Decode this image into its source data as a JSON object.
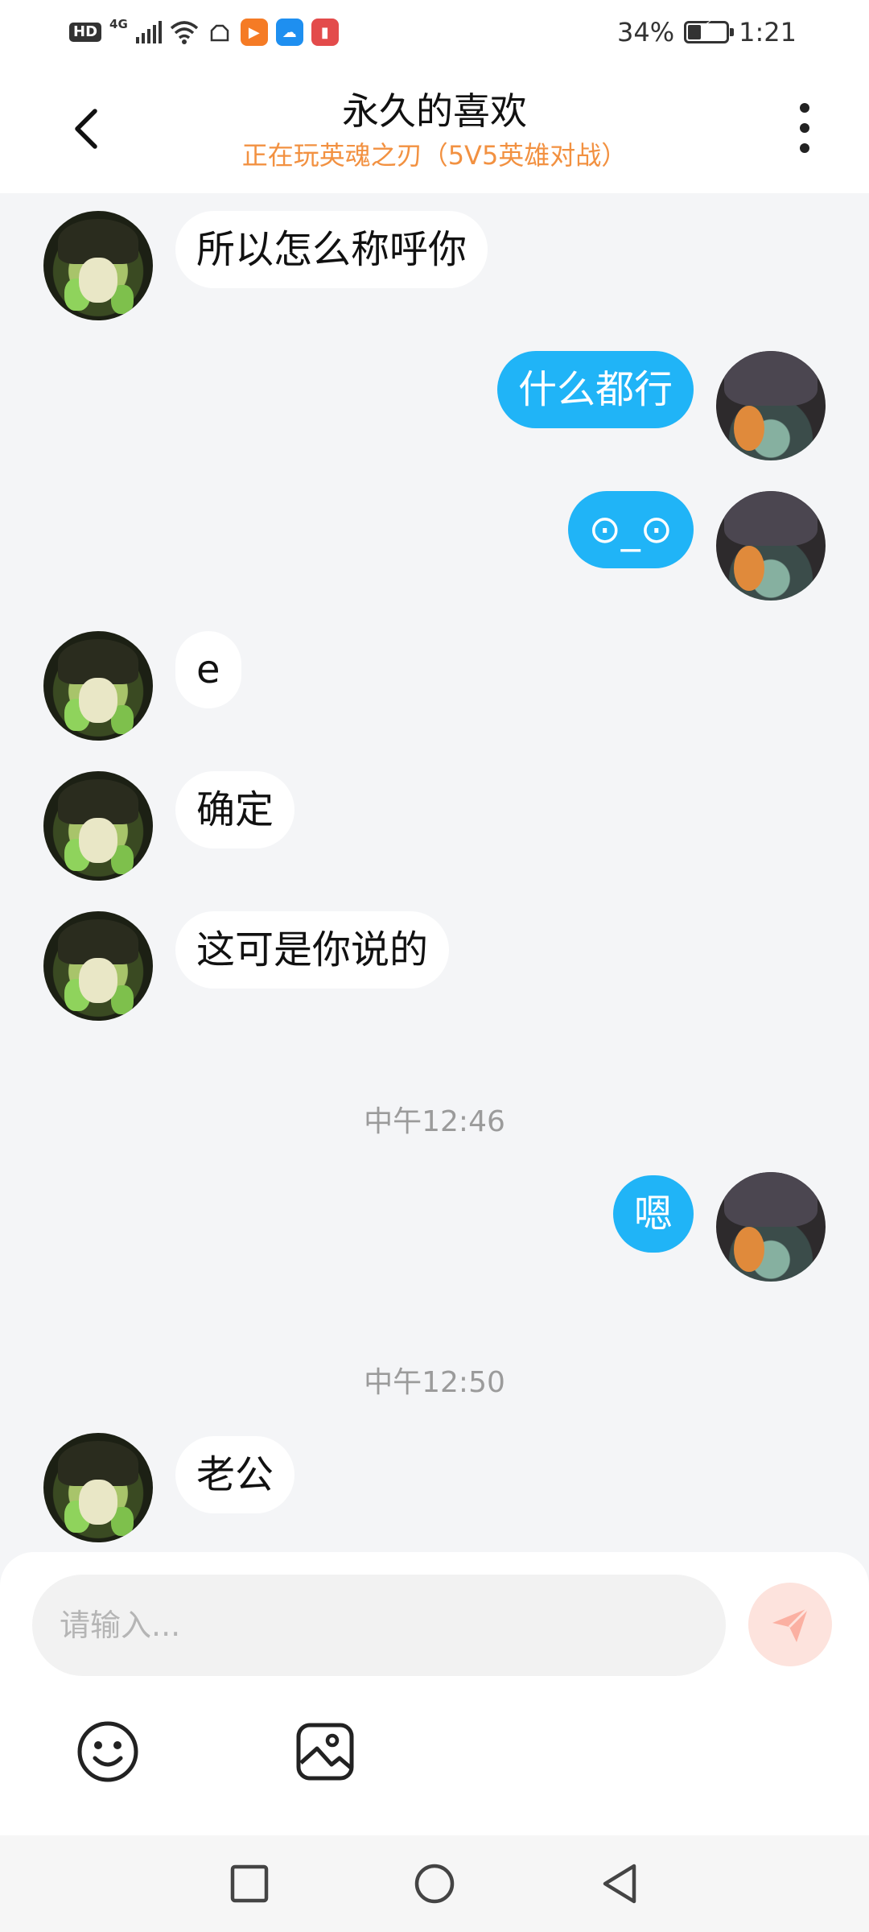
{
  "status_bar": {
    "hd_label": "HD",
    "network_label": "4G",
    "battery_percent_text": "34%",
    "battery_level": 0.34,
    "time": "1:21",
    "app_icons": [
      "cloud-icon",
      "video-app-icon",
      "weather-app-icon",
      "reader-app-icon"
    ]
  },
  "header": {
    "title": "永久的喜欢",
    "subtitle": "正在玩英魂之刃（5V5英雄对战）",
    "subtitle_color": "#f29141"
  },
  "messages": [
    {
      "side": "in",
      "text": "所以怎么称呼你"
    },
    {
      "side": "out",
      "text": "什么都行"
    },
    {
      "side": "out",
      "text": "⊙_⊙"
    },
    {
      "side": "in",
      "text": "e"
    },
    {
      "side": "in",
      "text": "确定"
    },
    {
      "side": "in",
      "text": "这可是你说的"
    },
    {
      "type": "time",
      "text": "中午12:46"
    },
    {
      "side": "out",
      "text": "嗯"
    },
    {
      "type": "time",
      "text": "中午12:50"
    },
    {
      "side": "in",
      "text": "老公"
    }
  ],
  "composer": {
    "placeholder": "请输入...",
    "send_icon": "send-icon",
    "tools": [
      "emoji-icon",
      "image-icon"
    ]
  },
  "nav_bar": [
    "recents-icon",
    "home-icon",
    "back-icon"
  ],
  "colors": {
    "outgoing_bubble": "#20b4f7",
    "incoming_bubble": "#ffffff",
    "background": "#f4f5f7",
    "send_button": "#fde3dd"
  }
}
